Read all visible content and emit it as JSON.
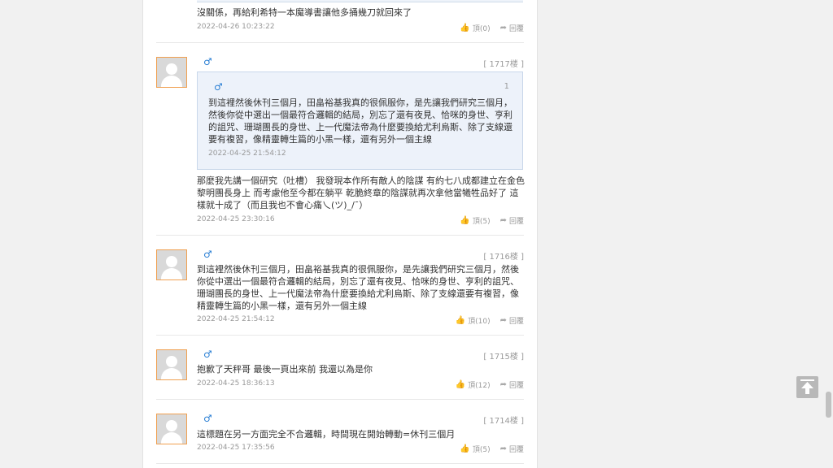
{
  "top_comment": {
    "text": "沒關係，再給利希特一本魔導書讓他多捅幾刀就回來了",
    "date": "2022-04-26 10:23:22",
    "like_label": "頂(0)",
    "reply_label": "回覆"
  },
  "comments": [
    {
      "gender": "♂",
      "floor": "[ 1717楼 ]",
      "quote": {
        "gender": "♂",
        "num": "1",
        "text": "到這裡然後休刊三個月，田畠裕基我真的很佩服你，是先讓我們研究三個月，然後你從中選出一個最符合邏輯的結局，別忘了還有夜見、恰咪的身世、亨利的詛咒、珊瑚團長的身世、上一代魔法帝為什麼要換給尤利烏斯、除了支線還要有複習，像精靈轉生篇的小黑一樣，還有另外一個主線",
        "date": "2022-04-25 21:54:12"
      },
      "text": "那麼我先講一個研究（吐槽） 我發現本作所有敵人的陰謀 有約七八成都建立在金色黎明團長身上 而考慮他至今都在躺平 乾脆終章的陰謀就再次拿他當犧牲品好了 這樣就十成了（而且我也不會心痛乀(ツ)_/¯）",
      "date": "2022-04-25 23:30:16",
      "like_label": "頂(5)",
      "reply_label": "回覆"
    },
    {
      "gender": "♂",
      "floor": "[ 1716楼 ]",
      "text": "到這裡然後休刊三個月，田畠裕基我真的很佩服你，是先讓我們研究三個月，然後你從中選出一個最符合邏輯的結局，別忘了還有夜見、恰咪的身世、亨利的詛咒、珊瑚團長的身世、上一代魔法帝為什麼要換給尤利烏斯、除了支線還要有複習，像精靈轉生篇的小黑一樣，還有另外一個主線",
      "date": "2022-04-25 21:54:12",
      "like_label": "頂(10)",
      "reply_label": "回覆"
    },
    {
      "gender": "♂",
      "floor": "[ 1715楼 ]",
      "text": "抱歉了天秤哥 最後一頁出來前 我還以為是你",
      "date": "2022-04-25 18:36:13",
      "like_label": "頂(12)",
      "reply_label": "回覆"
    },
    {
      "gender": "♂",
      "floor": "[ 1714楼 ]",
      "text": "這標題在另一方面完全不合邏輯，時間現在開始轉動=休刊三個月",
      "date": "2022-04-25 17:35:56",
      "like_label": "頂(5)",
      "reply_label": "回覆"
    }
  ],
  "icons": {
    "like": "thumbs-up-icon",
    "reply": "share-arrow-icon",
    "back_to_top": "arrow-up-icon"
  },
  "colors": {
    "gender_male": "#2a7fd4",
    "avatar_border": "#f0a050",
    "quote_bg": "#edf2fa"
  }
}
